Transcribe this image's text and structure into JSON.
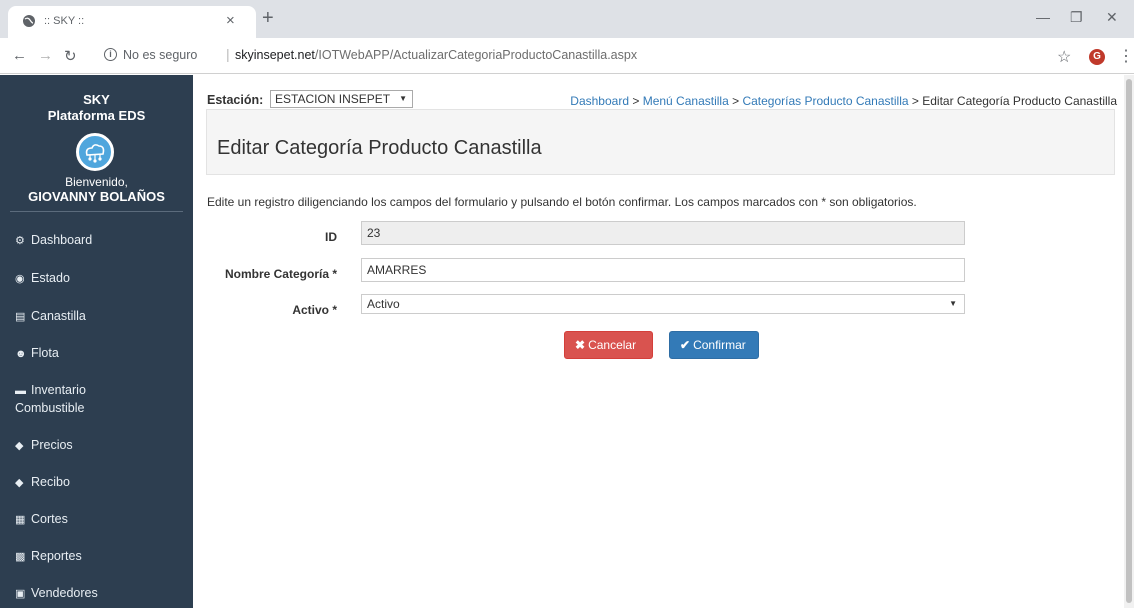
{
  "browser": {
    "tab_title": ":: SKY ::",
    "tab_close": "×",
    "new_tab": "+",
    "security_text": "No es seguro",
    "url_host": "skyinsepet.net",
    "url_path": "/IOTWebAPP/ActualizarCategoriaProductoCanastilla.aspx",
    "profile_initial": "G"
  },
  "sidebar": {
    "brand_line1": "SKY",
    "brand_line2": "Plataforma EDS",
    "welcome": "Bienvenido,",
    "username": "GIOVANNY BOLAÑOS",
    "items": [
      {
        "label": "Dashboard",
        "icon": "dashboard-icon"
      },
      {
        "label": "Estado",
        "icon": "eye-icon"
      },
      {
        "label": "Canastilla",
        "icon": "basket-icon"
      },
      {
        "label": "Flota",
        "icon": "group-icon"
      },
      {
        "label": "Inventario",
        "label2": "Combustible",
        "icon": "hdd-icon"
      },
      {
        "label": "Precios",
        "icon": "tags-icon"
      },
      {
        "label": "Recibo",
        "icon": "tag-icon"
      },
      {
        "label": "Cortes",
        "icon": "calendar-icon"
      },
      {
        "label": "Reportes",
        "icon": "bar-chart-icon"
      },
      {
        "label": "Vendedores",
        "icon": "id-card-icon"
      }
    ]
  },
  "header": {
    "estacion_label": "Estación:",
    "estacion_value": "ESTACION INSEPET",
    "breadcrumb": {
      "items": [
        "Dashboard",
        "Menú Canastilla",
        "Categorías Producto Canastilla"
      ],
      "current": "Editar Categoría Producto Canastilla",
      "separator": " > "
    }
  },
  "main": {
    "page_title": "Editar Categoría Producto Canastilla",
    "instructions": "Edite un registro diligenciando los campos del formulario y pulsando el botón confirmar. Los campos marcados con * son obligatorios.",
    "form": {
      "id_label": "ID",
      "id_value": "23",
      "nombre_label": "Nombre Categoría *",
      "nombre_value": "AMARRES",
      "activo_label": "Activo *",
      "activo_value": "Activo"
    },
    "buttons": {
      "cancel": "Cancelar",
      "confirm": "Confirmar"
    }
  }
}
